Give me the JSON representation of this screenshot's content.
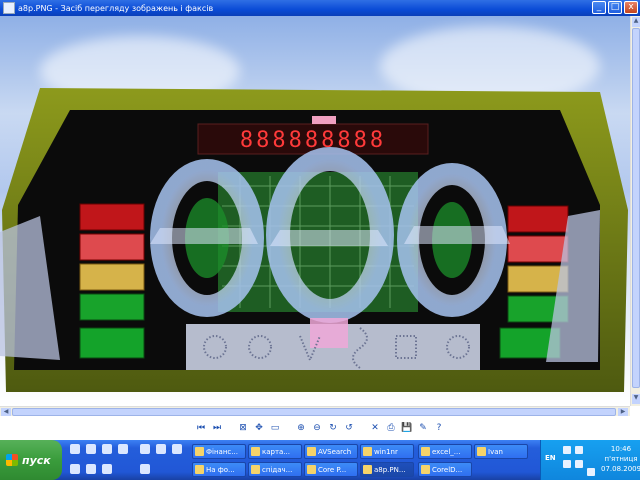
{
  "window": {
    "title": "a8p.PNG - Засіб перегляду зображень і факсів",
    "controls": {
      "minimize": "_",
      "maximize": "□",
      "close": "x"
    }
  },
  "viewer": {
    "led_display": "888888888",
    "toolbar": [
      {
        "name": "previous-image",
        "icon": "⏮"
      },
      {
        "name": "next-image",
        "icon": "⏭"
      },
      {
        "name": "best-fit",
        "icon": "⊠"
      },
      {
        "name": "actual-size",
        "icon": "✥"
      },
      {
        "name": "slideshow",
        "icon": "▭"
      },
      {
        "name": "zoom-in",
        "icon": "⊕"
      },
      {
        "name": "zoom-out",
        "icon": "⊖"
      },
      {
        "name": "rotate-clockwise",
        "icon": "↻"
      },
      {
        "name": "rotate-counterclockwise",
        "icon": "↺"
      },
      {
        "name": "delete",
        "icon": "✕"
      },
      {
        "name": "print",
        "icon": "⎙"
      },
      {
        "name": "save",
        "icon": "💾"
      },
      {
        "name": "edit",
        "icon": "✎"
      },
      {
        "name": "help",
        "icon": "?"
      }
    ]
  },
  "taskbar": {
    "start_label": "пуск",
    "row1": [
      {
        "label": "Фінанс...",
        "active": false
      },
      {
        "label": "картa...",
        "active": false
      },
      {
        "label": "AVSearch",
        "active": false
      },
      {
        "label": "win1nr",
        "active": false
      },
      {
        "label": "excel_...",
        "active": false
      },
      {
        "label": "Ivan",
        "active": false
      }
    ],
    "row2": [
      {
        "label": "На фо...",
        "active": false
      },
      {
        "label": "спідач...",
        "active": false
      },
      {
        "label": "Core P...",
        "active": false
      },
      {
        "label": "a8p.PN...",
        "active": true
      },
      {
        "label": "CorelD...",
        "active": false
      }
    ],
    "clock": {
      "time": "10:46",
      "day": "п'ятниця",
      "date": "07.08.2009"
    },
    "language": "EN"
  }
}
